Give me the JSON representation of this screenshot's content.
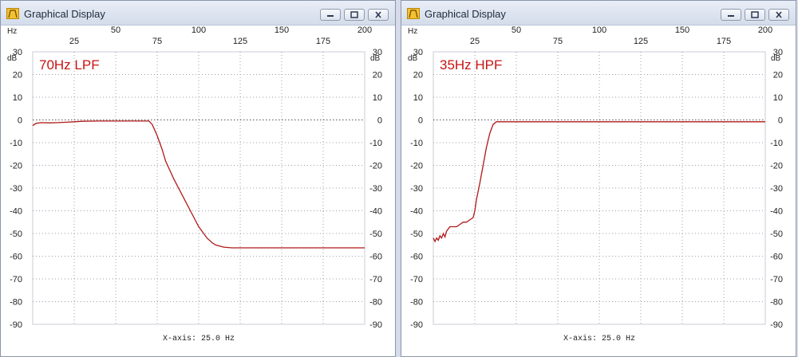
{
  "windows": [
    {
      "title": "Graphical Display",
      "annotation": "70Hz  LPF",
      "chart_data": {
        "type": "line",
        "x_unit": "Hz",
        "y_unit": "dB",
        "xlim": [
          0,
          200
        ],
        "ylim": [
          -90,
          30
        ],
        "x_ticks": [
          25,
          50,
          75,
          100,
          125,
          150,
          175,
          200
        ],
        "y_ticks": [
          30,
          20,
          10,
          0,
          -10,
          -20,
          -30,
          -40,
          -50,
          -60,
          -70,
          -80,
          -90
        ],
        "x_axis_caption": "X-axis: 25.0 Hz",
        "grid": true,
        "series": [
          {
            "color": "#b01818",
            "x": [
              0,
              2,
              5,
              10,
              15,
              20,
              25,
              30,
              40,
              50,
              60,
              65,
              70,
              72,
              75,
              78,
              80,
              85,
              90,
              95,
              100,
              105,
              108,
              110,
              115,
              120,
              130,
              150,
              180,
              200
            ],
            "y": [
              -2.5,
              -1.5,
              -1.2,
              -1.3,
              -1.2,
              -1.0,
              -0.8,
              -0.6,
              -0.5,
              -0.5,
              -0.5,
              -0.5,
              -0.5,
              -2,
              -7,
              -13,
              -18,
              -26,
              -33,
              -40,
              -47,
              -52,
              -54,
              -55,
              -56,
              -56.3,
              -56.3,
              -56.3,
              -56.3,
              -56.3
            ]
          }
        ]
      }
    },
    {
      "title": "Graphical Display",
      "annotation": "35Hz  HPF",
      "chart_data": {
        "type": "line",
        "x_unit": "Hz",
        "y_unit": "dB",
        "xlim": [
          0,
          200
        ],
        "ylim": [
          -90,
          30
        ],
        "x_ticks": [
          25,
          50,
          75,
          100,
          125,
          150,
          175,
          200
        ],
        "y_ticks": [
          30,
          20,
          10,
          0,
          -10,
          -20,
          -30,
          -40,
          -50,
          -60,
          -70,
          -80,
          -90
        ],
        "x_axis_caption": "X-axis: 25.0 Hz",
        "grid": true,
        "series": [
          {
            "color": "#b01818",
            "x": [
              0,
              1,
              2,
              3,
              4,
              5,
              6,
              7,
              8,
              10,
              12,
              14,
              16,
              18,
              20,
              22,
              24,
              25,
              26,
              28,
              30,
              32,
              34,
              36,
              38,
              40,
              50,
              100,
              150,
              200
            ],
            "y": [
              -52,
              -53.5,
              -52,
              -53,
              -51,
              -52,
              -50,
              -51.5,
              -49,
              -47,
              -47,
              -47,
              -46,
              -45,
              -45,
              -44,
              -43,
              -40,
              -35,
              -28,
              -20,
              -12,
              -6,
              -2,
              -0.8,
              -0.8,
              -0.8,
              -0.8,
              -0.8,
              -0.8
            ]
          }
        ]
      }
    }
  ]
}
